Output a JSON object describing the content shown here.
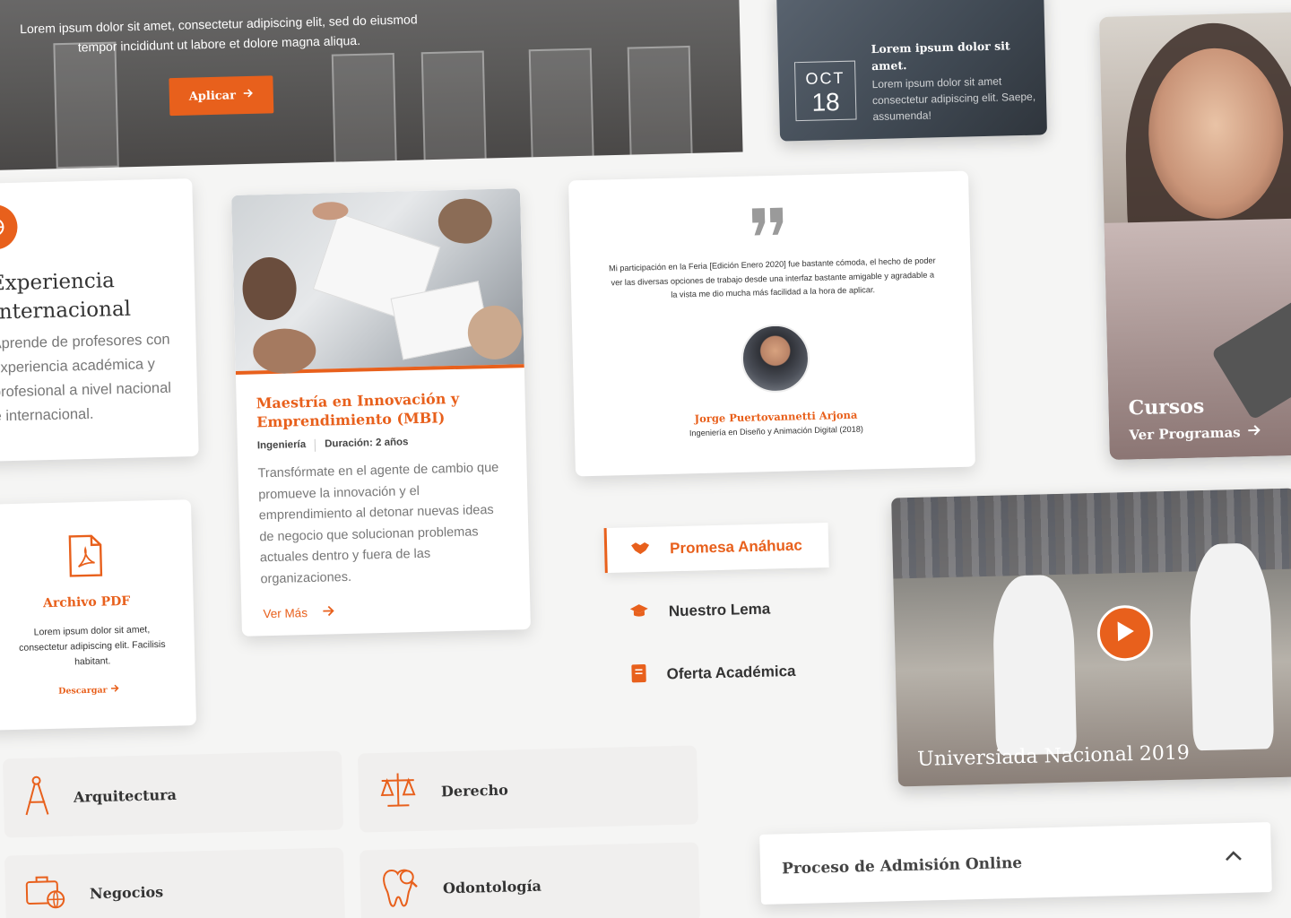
{
  "hero": {
    "text": "Lorem ipsum dolor sit amet, consectetur adipiscing elit, sed do eiusmod tempor incididunt ut labore et dolore magna aliqua.",
    "button_label": "Aplicar"
  },
  "event": {
    "month": "OCT",
    "day": "18",
    "title": "Lorem ipsum dolor sit amet.",
    "description": "Lorem ipsum dolor sit amet consectetur adipiscing elit. Saepe, assumenda!"
  },
  "cursos": {
    "title": "Cursos",
    "link_label": "Ver Programas"
  },
  "experience": {
    "title": "Experiencia Internacional",
    "text": "Aprende de profesores con experiencia académica y profesional a nivel nacional e internacional."
  },
  "program": {
    "title": "Maestría en Innovación y Emprendimiento (MBI)",
    "area": "Ingeniería",
    "duration": "Duración: 2 años",
    "description": "Transfórmate en el agente de cambio que promueve la innovación y el emprendimiento al detonar nuevas ideas de negocio que solucionan problemas actuales dentro y fuera de las organizaciones.",
    "more_label": "Ver Más"
  },
  "testimonial": {
    "text": "Mi participación en la Feria [Edición Enero 2020] fue bastante cómoda, el hecho de poder ver las diversas opciones de trabajo desde una interfaz bastante amigable y agradable a la vista me dio mucha más facilidad a la hora de aplicar.",
    "name": "Jorge Puertovannetti Arjona",
    "role": "Ingeniería en Diseño y Animación Digital (2018)"
  },
  "pdf": {
    "title": "Archivo PDF",
    "description": "Lorem ipsum dolor sit amet, consectetur adipiscing elit. Facilisis habitant.",
    "download_label": "Descargar"
  },
  "menu": {
    "items": [
      {
        "label": "Promesa Anáhuac",
        "icon": "handshake-icon",
        "active": true
      },
      {
        "label": "Nuestro Lema",
        "icon": "graduation-cap-icon",
        "active": false
      },
      {
        "label": "Oferta Académica",
        "icon": "book-icon",
        "active": false
      }
    ]
  },
  "video": {
    "title": "Universiada Nacional 2019",
    "icon": "play-icon"
  },
  "categories": [
    {
      "label": "Arquitectura",
      "icon": "compass-icon"
    },
    {
      "label": "Derecho",
      "icon": "scales-icon"
    },
    {
      "label": "Negocios",
      "icon": "briefcase-globe-icon"
    },
    {
      "label": "Odontología",
      "icon": "tooth-icon"
    }
  ],
  "accordion": {
    "title": "Proceso de Admisión Online",
    "icon": "chevron-up-icon"
  },
  "colors": {
    "accent": "#e8601c",
    "background": "#f5f5f4",
    "tile": "#f0efee"
  }
}
